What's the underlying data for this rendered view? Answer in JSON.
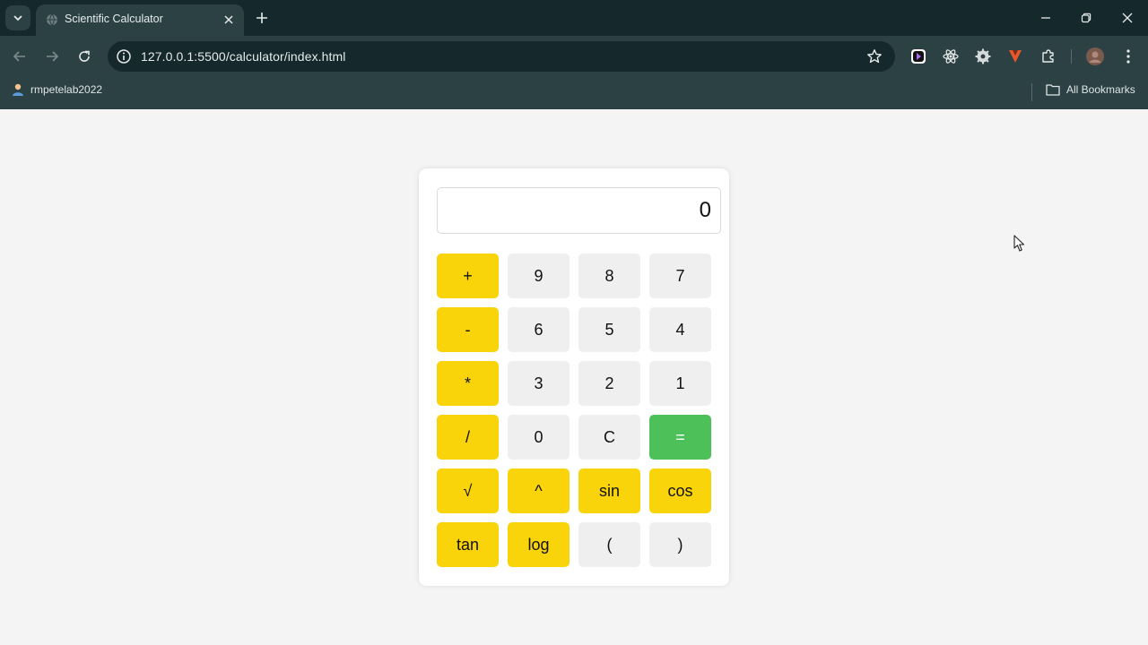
{
  "browser": {
    "tab_title": "Scientific Calculator",
    "url": "127.0.0.1:5500/calculator/index.html",
    "bookmark_profile": "rmpetelab2022",
    "all_bookmarks": "All Bookmarks"
  },
  "calculator": {
    "display": "0",
    "keys": [
      {
        "label": "+",
        "kind": "op"
      },
      {
        "label": "9",
        "kind": "num"
      },
      {
        "label": "8",
        "kind": "num"
      },
      {
        "label": "7",
        "kind": "num"
      },
      {
        "label": "-",
        "kind": "op"
      },
      {
        "label": "6",
        "kind": "num"
      },
      {
        "label": "5",
        "kind": "num"
      },
      {
        "label": "4",
        "kind": "num"
      },
      {
        "label": "*",
        "kind": "op"
      },
      {
        "label": "3",
        "kind": "num"
      },
      {
        "label": "2",
        "kind": "num"
      },
      {
        "label": "1",
        "kind": "num"
      },
      {
        "label": "/",
        "kind": "op"
      },
      {
        "label": "0",
        "kind": "num"
      },
      {
        "label": "C",
        "kind": "num"
      },
      {
        "label": "=",
        "kind": "eq"
      },
      {
        "label": "√",
        "kind": "op"
      },
      {
        "label": "^",
        "kind": "op"
      },
      {
        "label": "sin",
        "kind": "op"
      },
      {
        "label": "cos",
        "kind": "op"
      },
      {
        "label": "tan",
        "kind": "op"
      },
      {
        "label": "log",
        "kind": "op"
      },
      {
        "label": "(",
        "kind": "num"
      },
      {
        "label": ")",
        "kind": "num"
      }
    ]
  },
  "colors": {
    "operator_key": "#fad40b",
    "number_key": "#efefef",
    "equals_key": "#4dc05a",
    "browser_frame": "#2c4144",
    "tabstrip": "#15282b"
  },
  "icons": {
    "tab_search": "chevron-down-icon",
    "tab_favicon": "globe-icon",
    "tab_close": "close-icon",
    "new_tab": "plus-icon",
    "back": "arrow-left-icon",
    "forward": "arrow-right-icon",
    "reload": "reload-icon",
    "site_info": "info-icon",
    "bookmark_star": "star-icon",
    "extensions": "puzzle-icon",
    "menu": "more-vertical-icon",
    "folder": "folder-icon"
  }
}
